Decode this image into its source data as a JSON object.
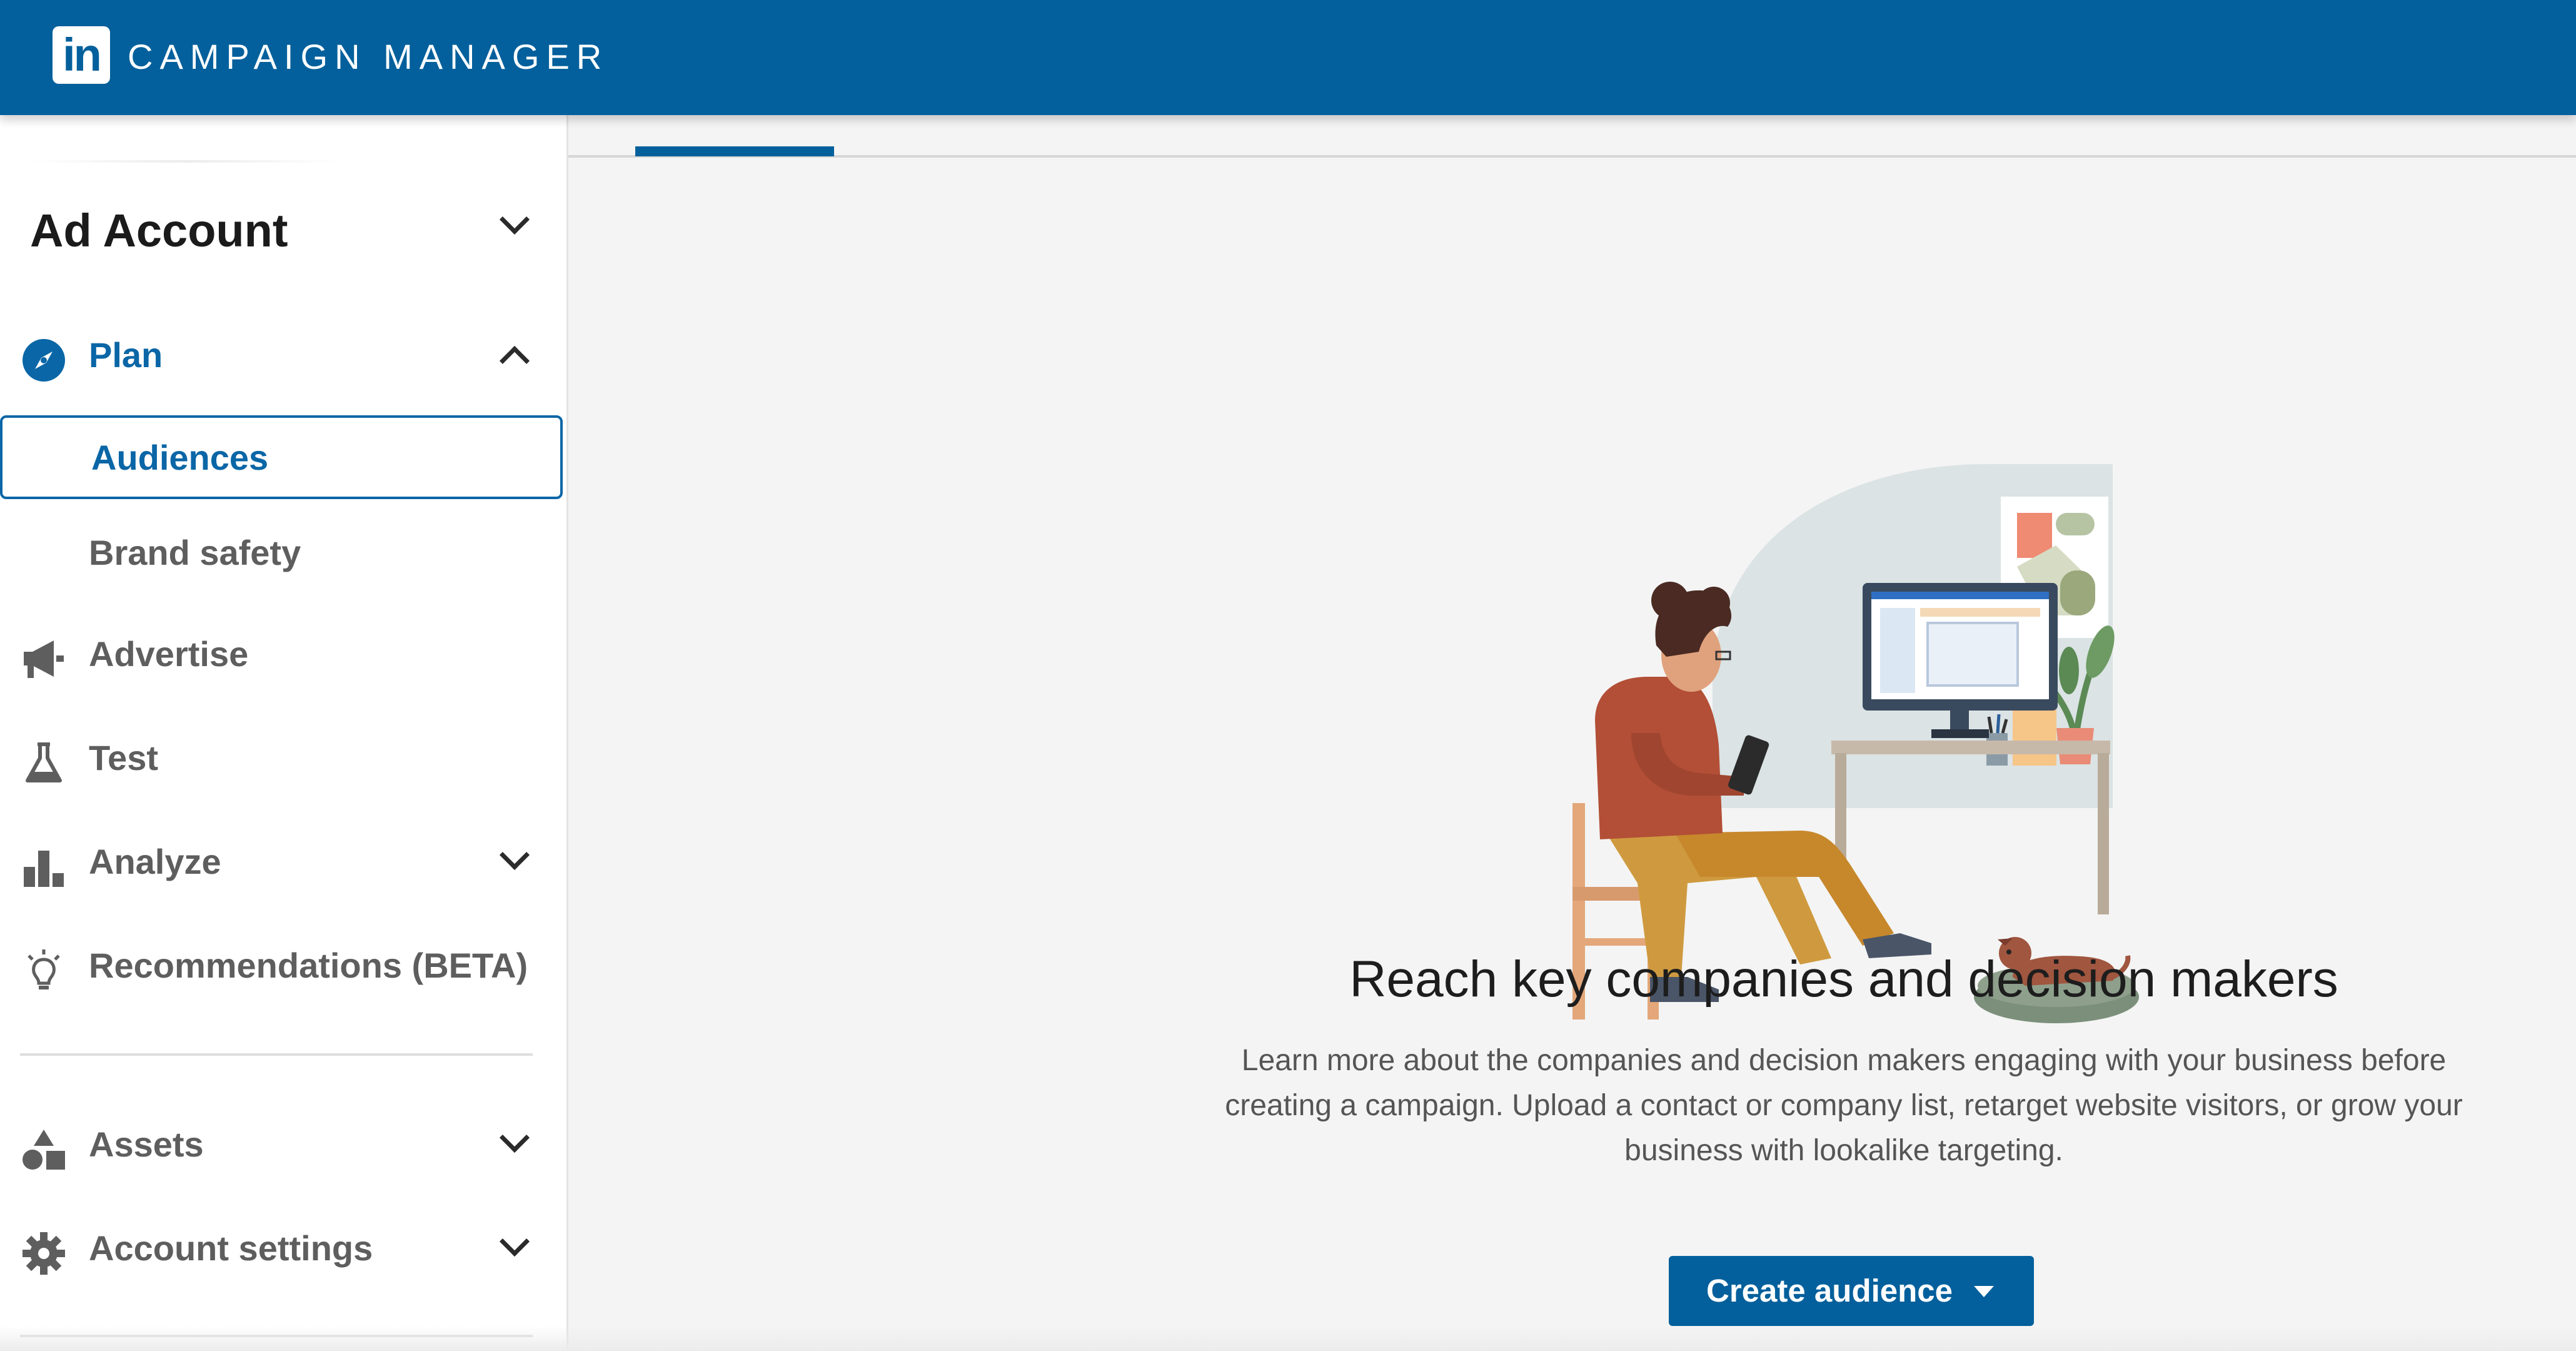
{
  "header": {
    "logo_text": "in",
    "title": "CAMPAIGN MANAGER",
    "background_color": "#04609c"
  },
  "sidebar": {
    "account_title": "Ad Account",
    "account_chevron_icon": "chevron-down-icon",
    "items": [
      {
        "label": "Plan",
        "icon": "compass-icon",
        "state": "expanded",
        "active": true
      },
      {
        "label": "Audiences",
        "selected": true
      },
      {
        "label": "Brand safety"
      },
      {
        "label": "Advertise",
        "icon": "megaphone-icon"
      },
      {
        "label": "Test",
        "icon": "flask-icon"
      },
      {
        "label": "Analyze",
        "icon": "bar-chart-icon",
        "state": "collapsed"
      },
      {
        "label": "Recommendations (BETA)",
        "icon": "lightbulb-icon"
      },
      {
        "label": "Assets",
        "icon": "shapes-icon",
        "state": "collapsed"
      },
      {
        "label": "Account settings",
        "icon": "gear-icon",
        "state": "collapsed"
      }
    ],
    "active_color": "#0a66a6"
  },
  "main": {
    "headline": "Reach key companies and decision makers",
    "description": "Learn more about the companies and decision makers engaging with your business before creating a campaign. Upload a contact or company list, retarget website visitors, or grow your business with lookalike targeting.",
    "create_button": {
      "label": "Create audience",
      "icon": "caret-down-icon"
    },
    "illustration": "person-at-desk-with-dog-illustration"
  }
}
